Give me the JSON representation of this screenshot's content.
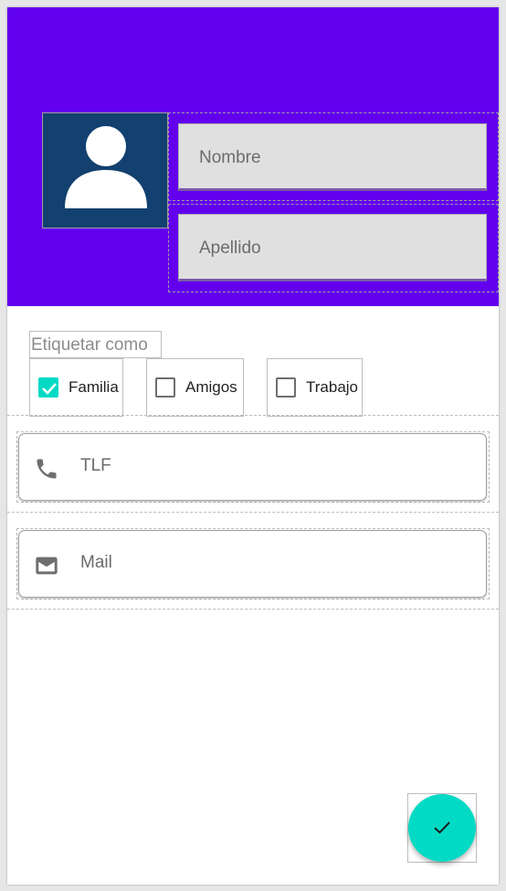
{
  "colors": {
    "primary": "#6200ee",
    "accent": "#03dac5",
    "avatar_bg": "#12406f"
  },
  "header": {
    "avatar_icon": "person-icon",
    "nombre_placeholder": "Nombre",
    "apellido_placeholder": "Apellido"
  },
  "tags": {
    "label": "Etiquetar como",
    "options": [
      {
        "label": "Familia",
        "checked": true
      },
      {
        "label": "Amigos",
        "checked": false
      },
      {
        "label": "Trabajo",
        "checked": false
      }
    ]
  },
  "fields": {
    "phone": {
      "icon": "phone-icon",
      "placeholder": "TLF"
    },
    "mail": {
      "icon": "mail-icon",
      "placeholder": "Mail"
    }
  },
  "fab": {
    "icon": "check-icon"
  }
}
